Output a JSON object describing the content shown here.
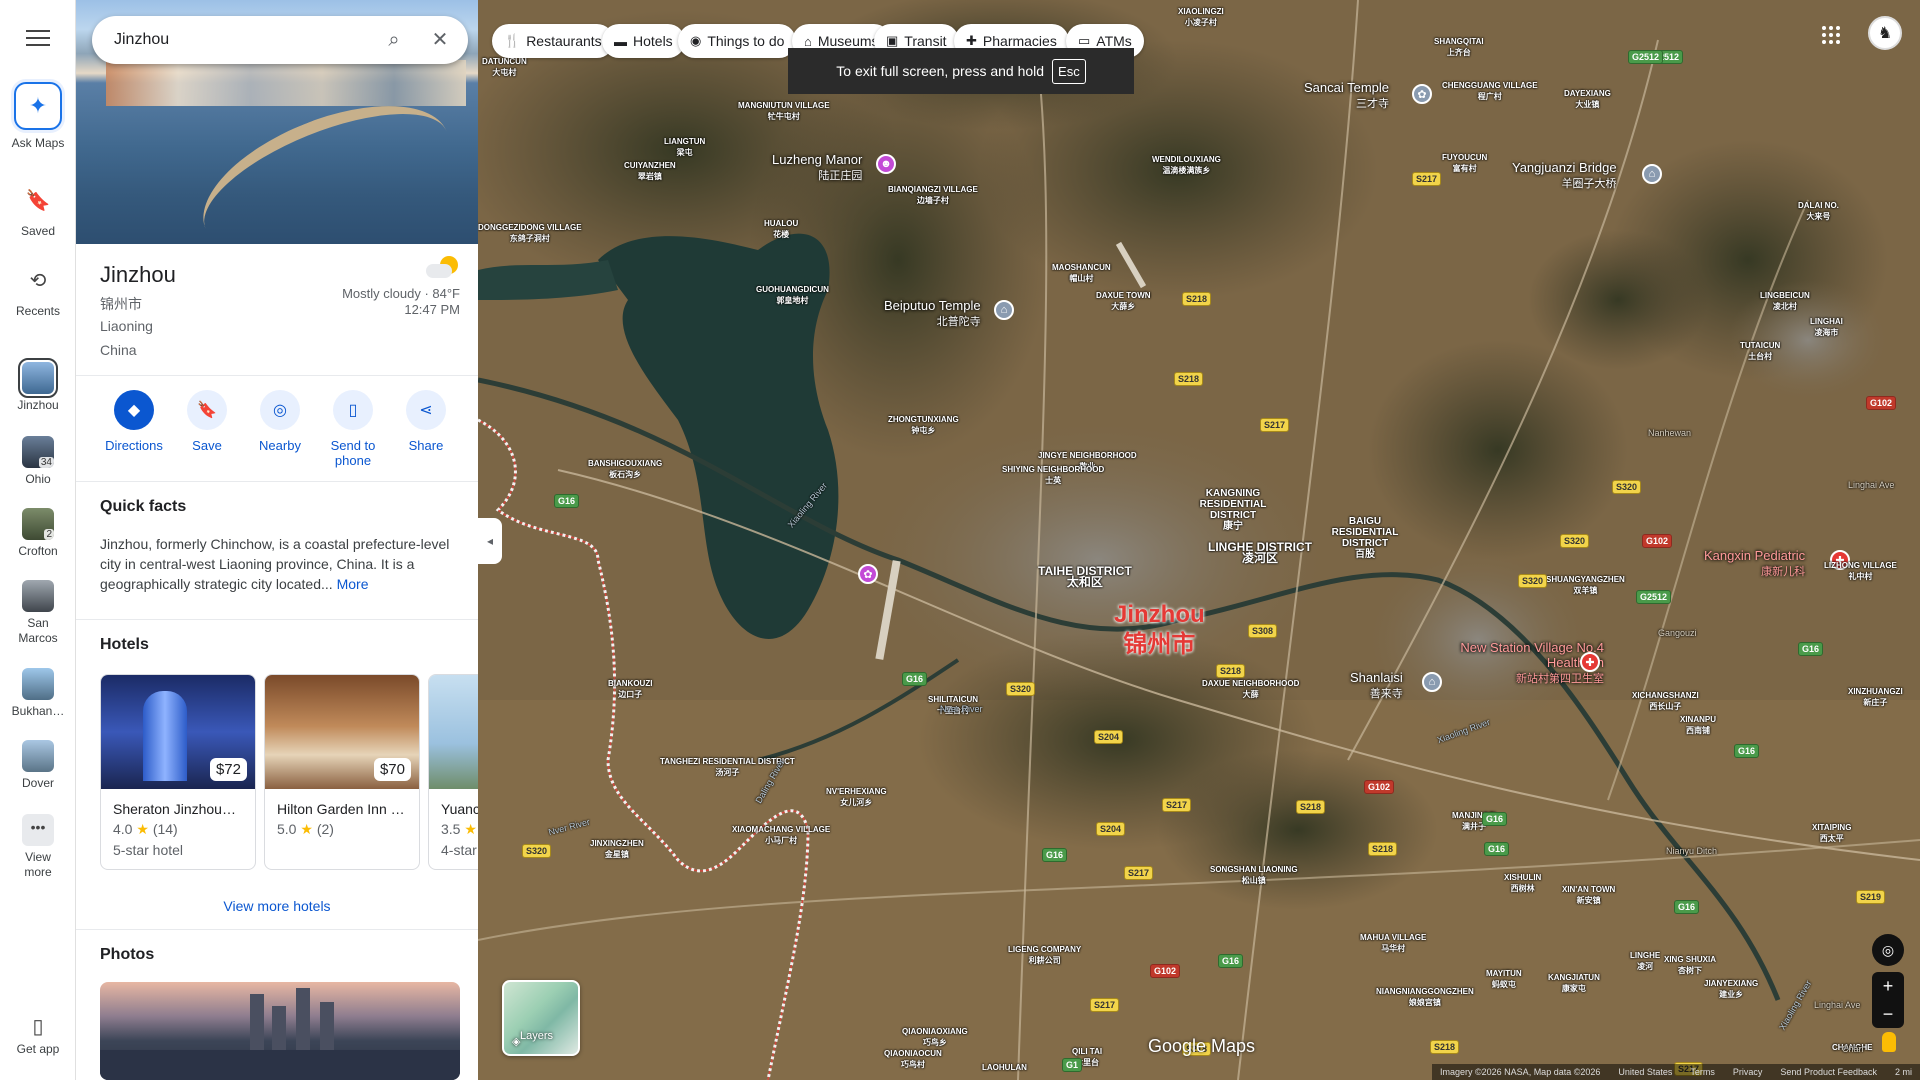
{
  "search": {
    "value": "Jinzhou"
  },
  "rail": {
    "ask": "Ask Maps",
    "saved": "Saved",
    "recents": "Recents",
    "history": [
      {
        "label": "Jinzhou",
        "badge": ""
      },
      {
        "label": "Ohio",
        "badge": "34"
      },
      {
        "label": "Crofton",
        "badge": "2"
      },
      {
        "label": "San Marcos",
        "badge": ""
      },
      {
        "label": "Bukhan…",
        "badge": ""
      },
      {
        "label": "Dover",
        "badge": ""
      }
    ],
    "view_more": "View more",
    "get_app": "Get app"
  },
  "place": {
    "name": "Jinzhou",
    "name_cn": "锦州市",
    "region": "Liaoning",
    "country": "China",
    "weather": "Mostly cloudy · 84°F",
    "time": "12:47 PM"
  },
  "actions": [
    "Directions",
    "Save",
    "Nearby",
    "Send to phone",
    "Share"
  ],
  "facts": {
    "title": "Quick facts",
    "text": "Jinzhou, formerly Chinchow, is a coastal prefecture-level city in central-west Liaoning province, China. It is a geographically strategic city located...",
    "more": "More"
  },
  "hotels": {
    "title": "Hotels",
    "items": [
      {
        "name": "Sheraton Jinzhou…",
        "price": "$72",
        "rating": "4.0",
        "reviews": "(14)",
        "type": "5-star hotel"
      },
      {
        "name": "Hilton Garden Inn …",
        "price": "$70",
        "rating": "5.0",
        "reviews": "(2)",
        "type": ""
      },
      {
        "name": "Yuanc",
        "price": "",
        "rating": "3.5",
        "reviews": "",
        "type": "4-star"
      }
    ],
    "view_more": "View more hotels"
  },
  "photos": {
    "title": "Photos"
  },
  "chips": [
    "Restaurants",
    "Hotels",
    "Things to do",
    "Museums",
    "Transit",
    "Pharmacies",
    "ATMs"
  ],
  "toast": {
    "text": "To exit full screen, press and hold",
    "key": "Esc"
  },
  "map": {
    "city": "Jinzhou",
    "city_cn": "锦州市",
    "pois": [
      {
        "name": "Luzheng Manor",
        "cn": "陆正庄园"
      },
      {
        "name": "Beiputuo Temple",
        "cn": "北普陀寺"
      },
      {
        "name": "Sancai Temple",
        "cn": "三才寺"
      },
      {
        "name": "Yangjuanzi Bridge",
        "cn": "羊圈子大桥"
      },
      {
        "name": "Shanlaisi",
        "cn": "善来寺"
      },
      {
        "name": "Kangxin Pediatric",
        "cn": "康新儿科"
      },
      {
        "name": "New Station Village No.4 Health Sh",
        "cn": "新站村第四卫生室"
      }
    ],
    "districts": [
      {
        "name": "TAIHE DISTRICT",
        "cn": "太和区"
      },
      {
        "name": "LINGHE DISTRICT",
        "cn": "凌河区"
      },
      {
        "name": "BAIGU RESIDENTIAL DISTRICT",
        "cn": "百股"
      },
      {
        "name": "KANGNING RESIDENTIAL DISTRICT",
        "cn": "康宁"
      }
    ],
    "places": [
      {
        "name": "XIAOLINGZI",
        "cn": "小凌子村"
      },
      {
        "name": "DATUNCUN",
        "cn": "大屯村"
      },
      {
        "name": "MANGNIUTUN VILLAGE",
        "cn": "牤牛屯村"
      },
      {
        "name": "LIANGTUN",
        "cn": "梁屯"
      },
      {
        "name": "CUIYANZHEN",
        "cn": "翠岩镇"
      },
      {
        "name": "DONGGEZIDONG VILLAGE",
        "cn": "东鸽子洞村"
      },
      {
        "name": "BIANQIANGZI VILLAGE",
        "cn": "边墙子村"
      },
      {
        "name": "HUALOU",
        "cn": "花楼"
      },
      {
        "name": "GUOHUANGDICUN",
        "cn": "郭皇地村"
      },
      {
        "name": "MAOSHANCUN",
        "cn": "帽山村"
      },
      {
        "name": "WENDILOUXIANG",
        "cn": "温滴楼满族乡"
      },
      {
        "name": "SHANGQITAI",
        "cn": "上齐台"
      },
      {
        "name": "CHENGGUANG VILLAGE",
        "cn": "程广村"
      },
      {
        "name": "DAYEXIANG",
        "cn": "大业镇"
      },
      {
        "name": "FUYOUCUN",
        "cn": "富有村"
      },
      {
        "name": "DALAI NO.",
        "cn": "大来号"
      },
      {
        "name": "DAXUE TOWN",
        "cn": "大薛乡"
      },
      {
        "name": "LINGBEICUN",
        "cn": "凌北村"
      },
      {
        "name": "LINGHAI",
        "cn": "凌海市"
      },
      {
        "name": "TUTAICUN",
        "cn": "土台村"
      },
      {
        "name": "BANSHIGOUXIANG",
        "cn": "板石沟乡"
      },
      {
        "name": "ZHONGTUNXIANG",
        "cn": "钟屯乡"
      },
      {
        "name": "JINGYE NEIGHBORHOOD",
        "cn": "敬业"
      },
      {
        "name": "SHIYING NEIGHBORHOOD",
        "cn": "士英"
      },
      {
        "name": "BIANKOUZI",
        "cn": "边口子"
      },
      {
        "name": "SHILITAICUN",
        "cn": "十里台村"
      },
      {
        "name": "DAXUE NEIGHBORHOOD",
        "cn": "大薛"
      },
      {
        "name": "SHUANGYANGZHEN",
        "cn": "双羊镇"
      },
      {
        "name": "XICHANGSHANZI",
        "cn": "西长山子"
      },
      {
        "name": "XINANPU",
        "cn": "西南铺"
      },
      {
        "name": "LIZHONG VILLAGE",
        "cn": "礼中村"
      },
      {
        "name": "XINZHUANGZI",
        "cn": "新庄子"
      },
      {
        "name": "TANGHEZI RESIDENTIAL DISTRICT",
        "cn": "汤河子"
      },
      {
        "name": "NV'ERHEXIANG",
        "cn": "女儿河乡"
      },
      {
        "name": "XIAOMACHANG VILLAGE",
        "cn": "小马厂村"
      },
      {
        "name": "JINXINGZHEN",
        "cn": "金星镇"
      },
      {
        "name": "MANJINGZI",
        "cn": "满井子"
      },
      {
        "name": "SONGSHAN LIAONING",
        "cn": "松山镇"
      },
      {
        "name": "XITAIPING",
        "cn": "西太平"
      },
      {
        "name": "XISHULIN",
        "cn": "西树林"
      },
      {
        "name": "XIN'AN TOWN",
        "cn": "新安镇"
      },
      {
        "name": "KANGJIATUN",
        "cn": "康家屯"
      },
      {
        "name": "LIGENG COMPANY",
        "cn": "利耕公司"
      },
      {
        "name": "MAHUA VILLAGE",
        "cn": "马华村"
      },
      {
        "name": "MAYITUN",
        "cn": "蚂蚁屯"
      },
      {
        "name": "LINGHE",
        "cn": "凌河"
      },
      {
        "name": "XING SHUXIA",
        "cn": "杏树下"
      },
      {
        "name": "JIANYEXIANG",
        "cn": "建业乡"
      },
      {
        "name": "NIANGNIANGGONGZHEN",
        "cn": "娘娘宫镇"
      },
      {
        "name": "QIAONIAOXIANG",
        "cn": "巧鸟乡"
      },
      {
        "name": "QIAONIAOCUN",
        "cn": "巧鸟村"
      },
      {
        "name": "LAOHULAN",
        "cn": ""
      },
      {
        "name": "QILI TAI",
        "cn": "七里台"
      },
      {
        "name": "CHANGHE",
        "cn": ""
      }
    ],
    "water_labels": [
      "Xiaoling River",
      "Nver River",
      "Xiaoling River",
      "Nver River",
      "Daling River",
      "Xiaoling River"
    ],
    "plain_labels": [
      "Nanhewan",
      "Gangouzi",
      "Nianyu Ditch",
      "Linghai Ave",
      "Linghai Ave",
      "Chan"
    ],
    "roads": [
      "G2512",
      "G2512",
      "S217",
      "S218",
      "S218",
      "S217",
      "G102",
      "S320",
      "S320",
      "G102",
      "S320",
      "G2512",
      "G16",
      "G16",
      "S308",
      "S218",
      "G16",
      "S320",
      "S204",
      "S217",
      "S218",
      "S204",
      "G102",
      "G16",
      "S218",
      "S217",
      "S320",
      "G16",
      "G16",
      "G16",
      "S219",
      "G102",
      "G16",
      "S217",
      "S218",
      "G1",
      "S218",
      "S217",
      "G16"
    ],
    "layers": "Layers",
    "logo": "Google Maps"
  },
  "footer": [
    "Imagery ©2026 NASA, Map data ©2026",
    "United States",
    "Terms",
    "Privacy",
    "Send Product Feedback",
    "2 mi"
  ],
  "colors": {
    "accent": "#0b57d0",
    "city_label": "#e53935",
    "poi_pink": "#c34ad6",
    "poi_red": "#e53935",
    "poi_gray": "#8a9bb0"
  }
}
